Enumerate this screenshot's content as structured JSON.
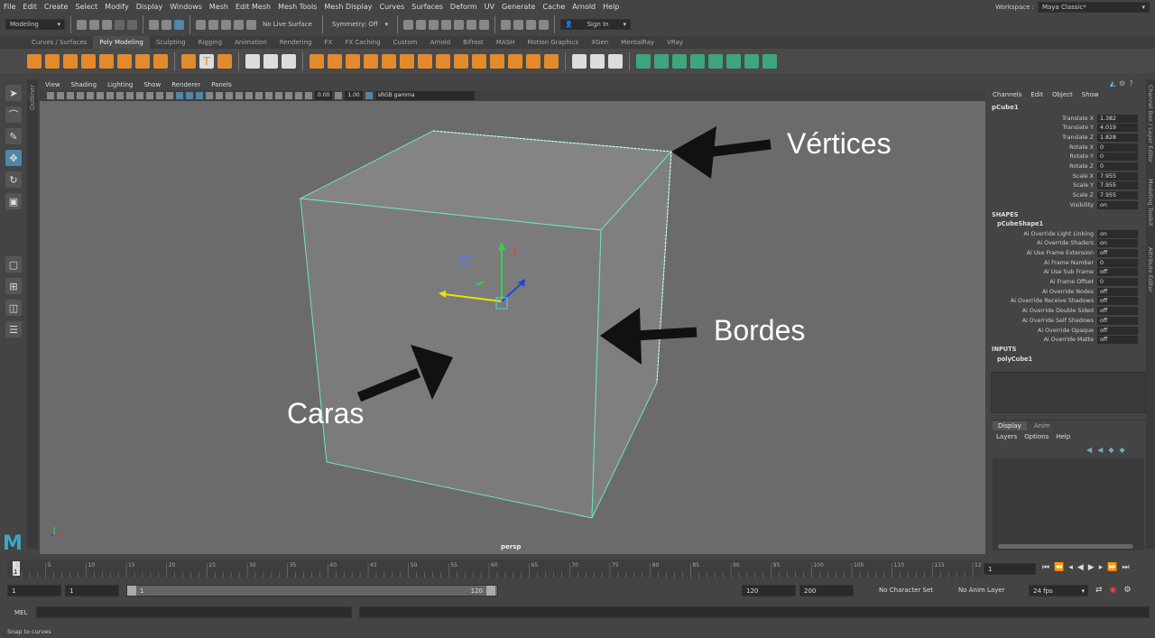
{
  "menus": [
    "File",
    "Edit",
    "Create",
    "Select",
    "Modify",
    "Display",
    "Windows",
    "Mesh",
    "Edit Mesh",
    "Mesh Tools",
    "Mesh Display",
    "Curves",
    "Surfaces",
    "Deform",
    "UV",
    "Generate",
    "Cache",
    "Arnold",
    "Help"
  ],
  "workspace": {
    "label": "Workspace :",
    "value": "Maya Classic*"
  },
  "status": {
    "mode": "Modeling",
    "live_surface": "No Live Surface",
    "symmetry": "Symmetry: Off",
    "sign_in": "Sign In"
  },
  "shelf_tabs": [
    "Curves / Surfaces",
    "Poly Modeling",
    "Sculpting",
    "Rigging",
    "Animation",
    "Rendering",
    "FX",
    "FX Caching",
    "Custom",
    "Arnold",
    "Bifrost",
    "MASH",
    "Motion Graphics",
    "XGen",
    "MentalRay",
    "VRay"
  ],
  "shelf_active": "Poly Modeling",
  "viewport": {
    "menu": [
      "View",
      "Shading",
      "Lighting",
      "Show",
      "Renderer",
      "Panels"
    ],
    "field1": "0.00",
    "field2": "1.00",
    "color_space": "sRGB gamma",
    "camera": "persp",
    "outliner_label": "Outliner"
  },
  "annotations": {
    "vertices": "Vértices",
    "edges": "Bordes",
    "faces": "Caras"
  },
  "channel_box": {
    "menu": [
      "Channels",
      "Edit",
      "Object",
      "Show"
    ],
    "object": "pCube1",
    "attributes": [
      {
        "label": "Translate X",
        "value": "1.382"
      },
      {
        "label": "Translate Y",
        "value": "4.019"
      },
      {
        "label": "Translate Z",
        "value": "1.828"
      },
      {
        "label": "Rotate X",
        "value": "0"
      },
      {
        "label": "Rotate Y",
        "value": "0"
      },
      {
        "label": "Rotate Z",
        "value": "0"
      },
      {
        "label": "Scale X",
        "value": "7.955"
      },
      {
        "label": "Scale Y",
        "value": "7.955"
      },
      {
        "label": "Scale Z",
        "value": "7.955"
      },
      {
        "label": "Visibility",
        "value": "on"
      }
    ],
    "shapes_header": "SHAPES",
    "shape_name": "pCubeShape1",
    "shape_attributes": [
      {
        "label": "Ai Override Light Linking",
        "value": "on"
      },
      {
        "label": "Ai Override Shaders",
        "value": "on"
      },
      {
        "label": "Ai Use Frame Extension",
        "value": "off"
      },
      {
        "label": "Ai Frame Number",
        "value": "0"
      },
      {
        "label": "Ai Use Sub Frame",
        "value": "off"
      },
      {
        "label": "Ai Frame Offset",
        "value": "0"
      },
      {
        "label": "Ai Override Nodes",
        "value": "off"
      },
      {
        "label": "Ai Override Receive Shadows",
        "value": "off"
      },
      {
        "label": "Ai Override Double Sided",
        "value": "off"
      },
      {
        "label": "Ai Override Self Shadows",
        "value": "off"
      },
      {
        "label": "Ai Override Opaque",
        "value": "off"
      },
      {
        "label": "Ai Override Matte",
        "value": "off"
      }
    ],
    "inputs_header": "INPUTS",
    "input_name": "polyCube1",
    "side_tabs": [
      "Channel Box / Layer Editor",
      "Modeling Toolkit",
      "Attribute Editor"
    ]
  },
  "layer_editor": {
    "tabs": [
      "Display",
      "Anim"
    ],
    "menu": [
      "Layers",
      "Options",
      "Help"
    ]
  },
  "timeline": {
    "ticks": [
      "1",
      "5",
      "10",
      "15",
      "20",
      "25",
      "30",
      "35",
      "40",
      "45",
      "50",
      "55",
      "60",
      "65",
      "70",
      "75",
      "80",
      "85",
      "90",
      "95",
      "100",
      "105",
      "110",
      "115",
      "120"
    ],
    "current_frame": "1"
  },
  "range": {
    "start": "1",
    "start2": "1",
    "slider_start": "1",
    "slider_end": "120",
    "end": "120",
    "end2": "200",
    "character_set": "No Character Set",
    "anim_layer": "No Anim Layer",
    "fps": "24 fps"
  },
  "command": {
    "label": "MEL"
  },
  "help_line": "Snap to curves"
}
